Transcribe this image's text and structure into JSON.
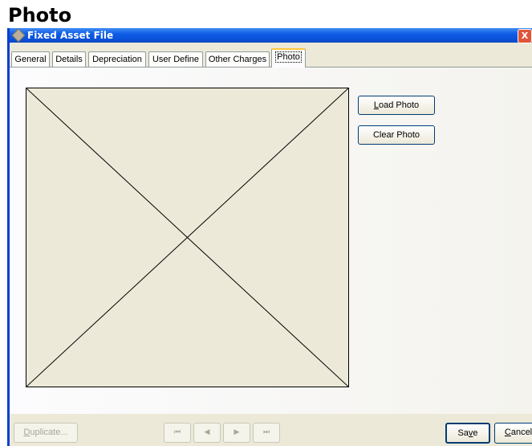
{
  "page_title": "Photo",
  "window": {
    "title": "Fixed Asset File",
    "close_glyph": "X"
  },
  "tabs": [
    "General",
    "Details",
    "Depreciation",
    "User Define",
    "Other Charges",
    "Photo"
  ],
  "active_tab": "Photo",
  "photo_buttons": {
    "load_prefix": "L",
    "load_rest": "oad Photo",
    "clear": "Clear Photo"
  },
  "footer": {
    "duplicate_prefix": "D",
    "duplicate_rest": "uplicate...",
    "nav_first": "⏮",
    "nav_prev": "◀",
    "nav_next": "▶",
    "nav_last": "⏭",
    "save_a": "Sa",
    "save_u": "v",
    "save_b": "e",
    "cancel_u": "C",
    "cancel_rest": "ancel"
  },
  "icons": {
    "window": "window-icon",
    "close": "close-icon",
    "first": "first-record-icon",
    "prev": "previous-record-icon",
    "next": "next-record-icon",
    "last": "last-record-icon"
  }
}
